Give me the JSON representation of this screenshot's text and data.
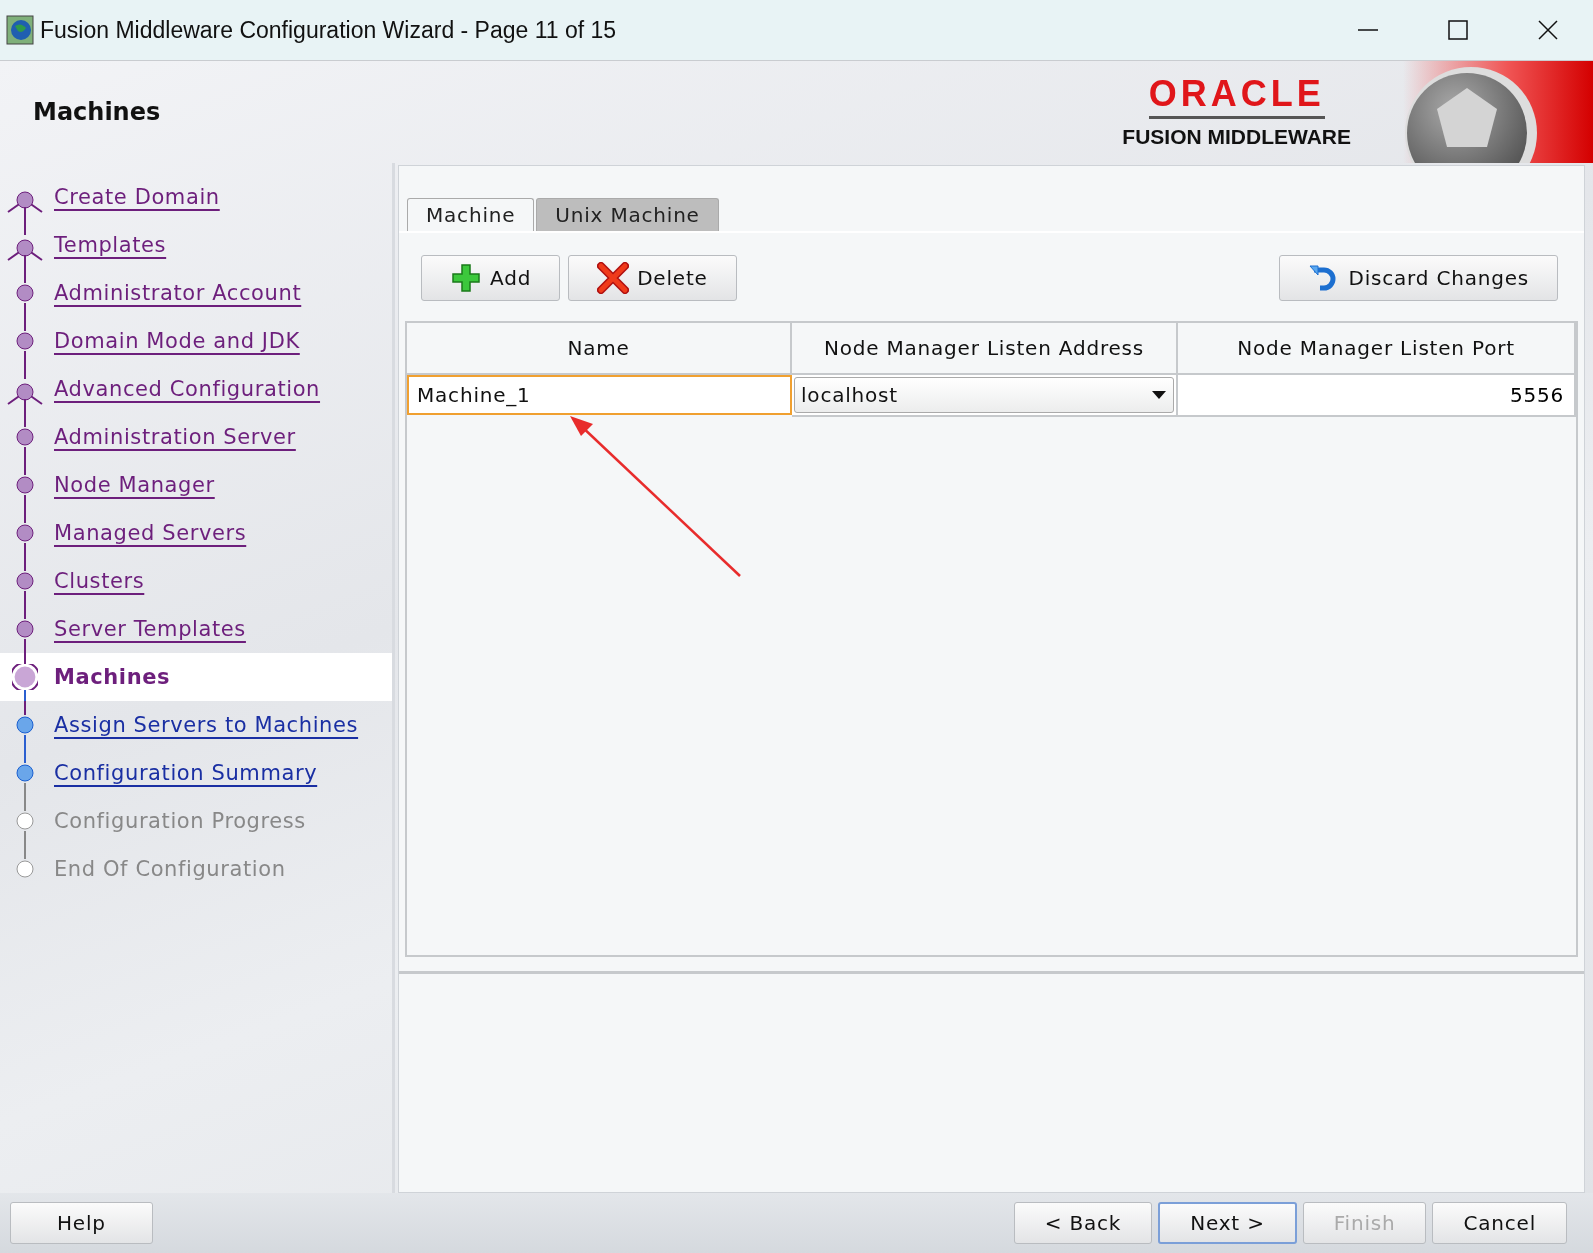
{
  "window": {
    "title": "Fusion Middleware Configuration Wizard - Page 11 of 15"
  },
  "header": {
    "title": "Machines",
    "brand": "ORACLE",
    "product": "FUSION MIDDLEWARE"
  },
  "steps": [
    {
      "label": "Create Domain",
      "kind": "done",
      "branch": true
    },
    {
      "label": "Templates",
      "kind": "done",
      "branch": true
    },
    {
      "label": "Administrator Account",
      "kind": "done",
      "branch": false
    },
    {
      "label": "Domain Mode and JDK",
      "kind": "done",
      "branch": false
    },
    {
      "label": "Advanced Configuration",
      "kind": "done",
      "branch": true
    },
    {
      "label": "Administration Server",
      "kind": "done",
      "branch": false
    },
    {
      "label": "Node Manager",
      "kind": "done",
      "branch": false
    },
    {
      "label": "Managed Servers",
      "kind": "done",
      "branch": false
    },
    {
      "label": "Clusters",
      "kind": "done",
      "branch": false
    },
    {
      "label": "Server Templates",
      "kind": "done",
      "branch": false
    },
    {
      "label": "Machines",
      "kind": "current",
      "branch": false
    },
    {
      "label": "Assign Servers to Machines",
      "kind": "next",
      "branch": false
    },
    {
      "label": "Configuration Summary",
      "kind": "next",
      "branch": false
    },
    {
      "label": "Configuration Progress",
      "kind": "future",
      "branch": false
    },
    {
      "label": "End Of Configuration",
      "kind": "future",
      "branch": false
    }
  ],
  "tabs": [
    {
      "label": "Machine",
      "selected": true
    },
    {
      "label": "Unix Machine",
      "selected": false
    }
  ],
  "toolbar": [
    {
      "label": "Add",
      "kind": "add"
    },
    {
      "label": "Delete",
      "kind": "delete"
    },
    {
      "label": "Discard Changes",
      "kind": "discard"
    }
  ],
  "table": {
    "columns": [
      "Name",
      "Node Manager Listen Address",
      "Node Manager Listen Port"
    ],
    "rows": [
      {
        "name": "Machine_1",
        "address": "localhost",
        "port": "5556"
      }
    ]
  },
  "annotation": {
    "kind": "arrow"
  },
  "buttons": [
    {
      "label": "Help",
      "kind": "help",
      "disabled": false,
      "selected": false
    },
    {
      "label": "< Back",
      "kind": "nav",
      "disabled": false,
      "selected": false
    },
    {
      "label": "Next >",
      "kind": "nav",
      "disabled": false,
      "selected": true
    },
    {
      "label": "Finish",
      "kind": "nav",
      "disabled": true,
      "selected": false
    },
    {
      "label": "Cancel",
      "kind": "nav",
      "disabled": false,
      "selected": false
    }
  ]
}
